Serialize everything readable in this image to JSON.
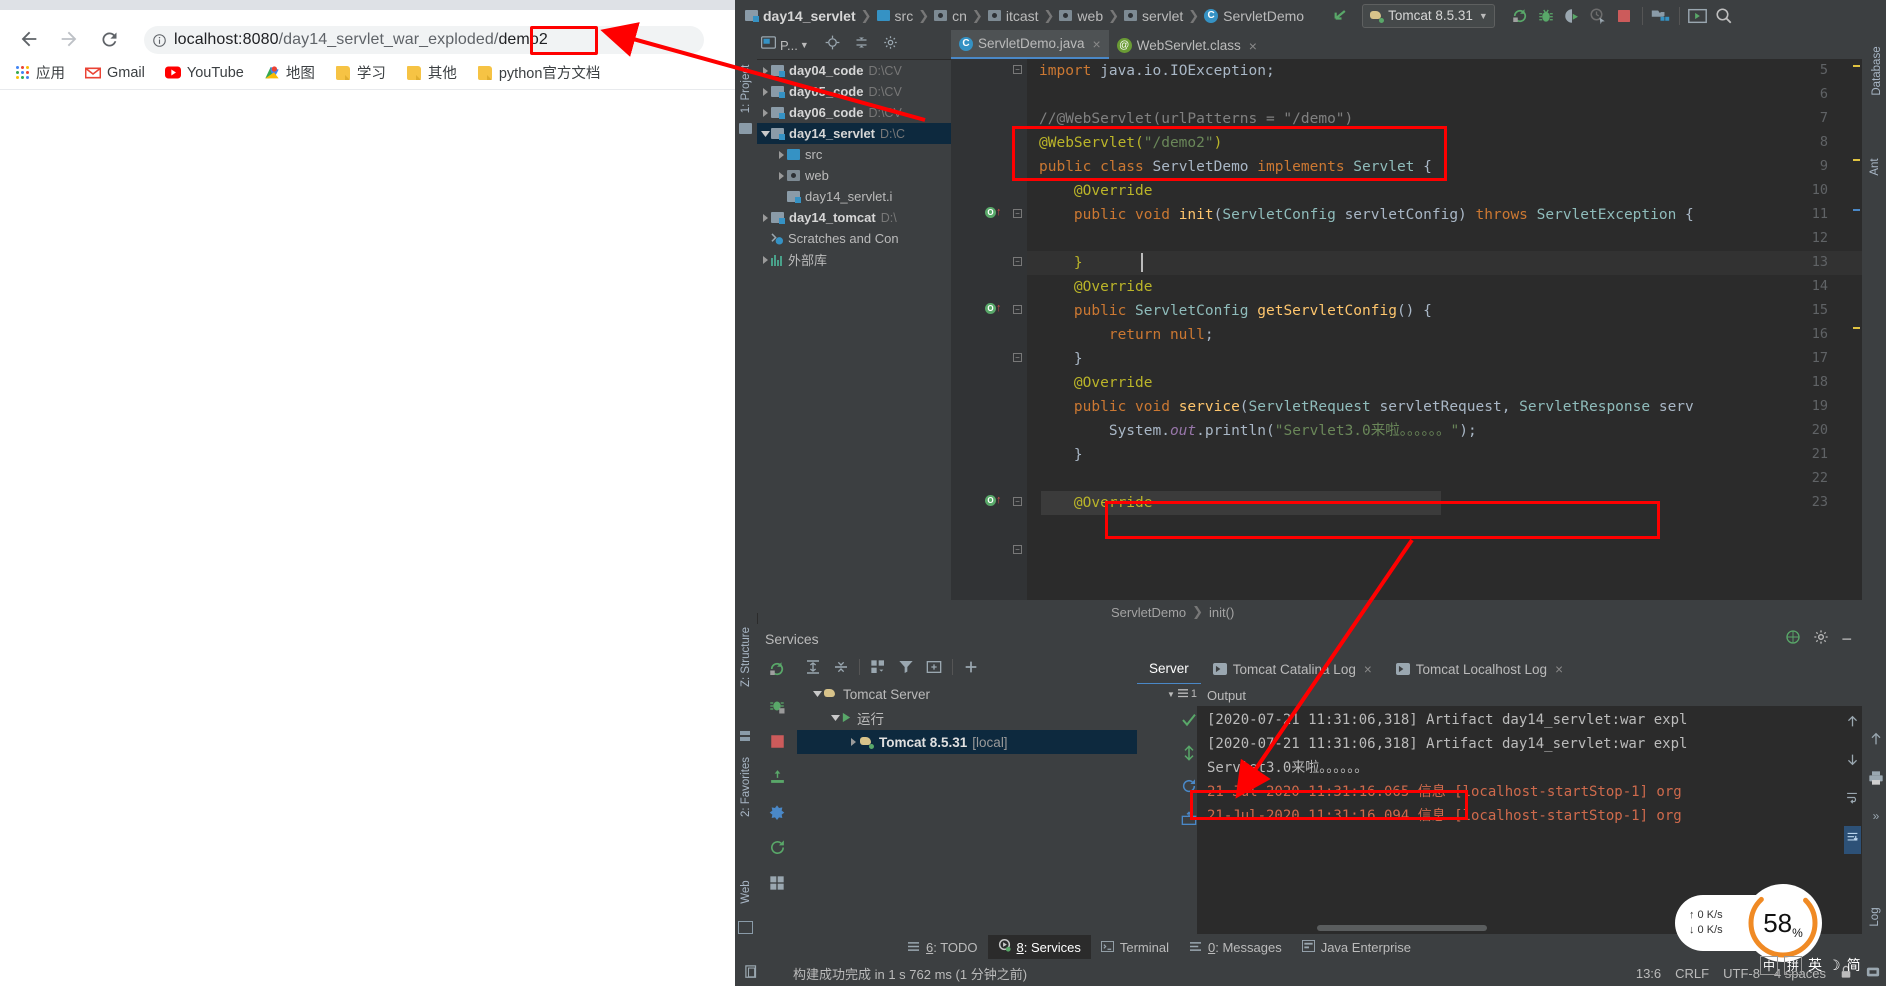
{
  "browser": {
    "nav": {
      "back": "back-arrow",
      "forward": "forward-arrow",
      "reload": "reload"
    },
    "omnibox": {
      "info_icon": "info-circle-icon",
      "host": "localhost:8080",
      "path": "/day14_servlet_war_exploded/",
      "highlight": "demo2",
      "full_url": "localhost:8080/day14_servlet_war_exploded/demo2"
    },
    "bookmarks": [
      {
        "label": "应用",
        "icon": "apps-grid-icon"
      },
      {
        "label": "Gmail",
        "icon": "gmail-icon"
      },
      {
        "label": "YouTube",
        "icon": "youtube-icon"
      },
      {
        "label": "地图",
        "icon": "maps-icon"
      },
      {
        "label": "学习",
        "icon": "folder-icon"
      },
      {
        "label": "其他",
        "icon": "folder-icon"
      },
      {
        "label": "python官方文档",
        "icon": "folder-icon"
      }
    ]
  },
  "idea": {
    "breadcrumb": [
      {
        "label": "day14_servlet",
        "icon": "module-icon",
        "bold": true
      },
      {
        "label": "src",
        "icon": "source-root-icon",
        "bold": false
      },
      {
        "label": "cn",
        "icon": "package-icon",
        "bold": false
      },
      {
        "label": "itcast",
        "icon": "package-icon",
        "bold": false
      },
      {
        "label": "web",
        "icon": "package-icon",
        "bold": false
      },
      {
        "label": "servlet",
        "icon": "package-icon",
        "bold": false
      },
      {
        "label": "ServletDemo",
        "icon": "class-icon",
        "bold": false
      }
    ],
    "run_config": {
      "label": "Tomcat 8.5.31",
      "icon": "tomcat-icon",
      "chevron": "▼"
    },
    "toolbar_icons": [
      "run-icon",
      "debug-icon",
      "run-coverage-icon",
      "profile-icon",
      "stop-icon",
      "build-artifacts-icon",
      "tomcat-console-icon",
      "search-everywhere-icon"
    ],
    "left_strip": [
      "1: Project",
      "Z: Structure",
      "2: Favorites",
      "Web"
    ],
    "right_strip": [
      "Database",
      "Ant"
    ],
    "project_panel": {
      "title": "P...",
      "tree": [
        {
          "label": "day04_code",
          "path": "D:\\CV",
          "indent": 0,
          "expander": "collapsed",
          "icon": "module-icon",
          "bold": true,
          "selected": false
        },
        {
          "label": "day05_code",
          "path": "D:\\CV",
          "indent": 0,
          "expander": "collapsed",
          "icon": "module-icon",
          "bold": true,
          "selected": false
        },
        {
          "label": "day06_code",
          "path": "D:\\CV",
          "indent": 0,
          "expander": "collapsed",
          "icon": "module-icon",
          "bold": true,
          "selected": false
        },
        {
          "label": "day14_servlet",
          "path": "D:\\C",
          "indent": 0,
          "expander": "expanded",
          "icon": "module-icon",
          "bold": true,
          "selected": true
        },
        {
          "label": "src",
          "path": "",
          "indent": 1,
          "expander": "collapsed",
          "icon": "source-root-icon",
          "bold": false,
          "selected": false
        },
        {
          "label": "web",
          "path": "",
          "indent": 1,
          "expander": "collapsed",
          "icon": "web-root-icon",
          "bold": false,
          "selected": false
        },
        {
          "label": "day14_servlet.i",
          "path": "",
          "indent": 1,
          "expander": "none",
          "icon": "iml-file-icon",
          "bold": false,
          "selected": false
        },
        {
          "label": "day14_tomcat",
          "path": "D:\\",
          "indent": 0,
          "expander": "collapsed",
          "icon": "module-icon",
          "bold": true,
          "selected": false
        },
        {
          "label": "Scratches and Con",
          "path": "",
          "indent": 0,
          "expander": "none",
          "icon": "scratches-icon",
          "bold": false,
          "selected": false
        },
        {
          "label": "外部库",
          "path": "",
          "indent": 0,
          "expander": "collapsed",
          "icon": "library-icon",
          "bold": false,
          "selected": false
        }
      ]
    },
    "editor": {
      "tabs": [
        {
          "label": "ServletDemo.java",
          "icon": "java-class-icon",
          "active": true,
          "closable": true
        },
        {
          "label": "WebServlet.class",
          "icon": "annotation-icon",
          "active": false,
          "closable": true
        }
      ],
      "first_line_number": 5,
      "lines": [
        {
          "n": 5,
          "text": "import java.io.IOException;"
        },
        {
          "n": 6,
          "text": ""
        },
        {
          "n": 7,
          "text": "//@WebServlet(urlPatterns = \"/demo\")"
        },
        {
          "n": 8,
          "text": "@WebServlet(\"/demo2\")"
        },
        {
          "n": 9,
          "text": "public class ServletDemo implements Servlet {"
        },
        {
          "n": 10,
          "text": "    @Override"
        },
        {
          "n": 11,
          "text": "    public void init(ServletConfig servletConfig) throws ServletException {"
        },
        {
          "n": 12,
          "text": ""
        },
        {
          "n": 13,
          "text": "    }"
        },
        {
          "n": 14,
          "text": "    @Override"
        },
        {
          "n": 15,
          "text": "    public ServletConfig getServletConfig() {"
        },
        {
          "n": 16,
          "text": "        return null;"
        },
        {
          "n": 17,
          "text": "    }"
        },
        {
          "n": 18,
          "text": "    @Override"
        },
        {
          "n": 19,
          "text": "    public void service(ServletRequest servletRequest, ServletResponse serv"
        },
        {
          "n": 20,
          "text": "        System.out.println(\"Servlet3.0来啦。。。。。。\");"
        },
        {
          "n": 21,
          "text": "    }"
        },
        {
          "n": 22,
          "text": ""
        },
        {
          "n": 23,
          "text": "    @Override"
        }
      ],
      "breadcrumb": [
        "ServletDemo",
        "init()"
      ],
      "caret_line": 13
    },
    "services": {
      "title": "Services",
      "toolbar_icons": [
        "rerun-icon",
        "expand-all-icon",
        "collapse-all-icon",
        "group-by-icon",
        "filter-icon",
        "add-frame-icon",
        "add-icon"
      ],
      "left_icons": [
        "rerun-icon",
        "debug-icon",
        "stop-icon",
        "deploy-icon",
        "settings-icon",
        "restart-icon",
        "layout-icon"
      ],
      "tree": [
        {
          "label": "Tomcat Server",
          "indent": 0,
          "expander": "expanded",
          "icon": "tomcat-icon",
          "bold": false,
          "selected": false
        },
        {
          "label": "运行",
          "indent": 1,
          "expander": "expanded",
          "icon": "run-green-icon",
          "bold": false,
          "selected": false
        },
        {
          "label": "Tomcat 8.5.31",
          "suffix": "[local]",
          "indent": 2,
          "expander": "collapsed",
          "icon": "tomcat-run-icon",
          "bold": true,
          "selected": true
        }
      ],
      "tabs": [
        {
          "label": "Server",
          "active": true,
          "closable": false,
          "icon": ""
        },
        {
          "label": "Tomcat Catalina Log",
          "active": false,
          "closable": true,
          "icon": "log-icon"
        },
        {
          "label": "Tomcat Localhost Log",
          "active": false,
          "closable": true,
          "icon": "log-icon"
        }
      ],
      "output_label": "Output",
      "filter_badge": "1",
      "console_lines": [
        {
          "text": "[2020-07-21 11:31:06,318] Artifact day14_servlet:war expl",
          "style": "normal"
        },
        {
          "text": "[2020-07-21 11:31:06,318] Artifact day14_servlet:war expl",
          "style": "normal"
        },
        {
          "text": "Servlet3.0来啦。。。。。。",
          "style": "normal"
        },
        {
          "text": "21-Jul-2020 11:31:16.065 信息 [localhost-startStop-1] org",
          "style": "error"
        },
        {
          "text": "21-Jul-2020 11:31:16.094 信息 [localhost-startStop-1] org",
          "style": "error"
        }
      ]
    },
    "bottom_tabs": [
      {
        "num": "6",
        "label": ": TODO",
        "icon": "todo-icon",
        "active": false
      },
      {
        "num": "8",
        "label": ": Services",
        "icon": "services-icon",
        "active": true
      },
      {
        "num": "",
        "label": "Terminal",
        "icon": "terminal-icon",
        "active": false
      },
      {
        "num": "0",
        "label": ": Messages",
        "icon": "messages-icon",
        "active": false
      },
      {
        "num": "",
        "label": "Java Enterprise",
        "icon": "java-enterprise-icon",
        "active": false
      }
    ],
    "statusbar": {
      "message": "构建成功完成 in 1 s 762 ms (1 分钟之前)",
      "caret_position": "13:6",
      "line_separator": "CRLF",
      "encoding": "UTF-8",
      "indent": "4 spaces",
      "lock_icon": "lock-icon"
    }
  },
  "overlay": {
    "net_up": "↑ 0   K/s",
    "net_down": "↓ 0   K/s",
    "cpu_value": "58",
    "cpu_unit": "%",
    "tray_items": [
      "中",
      "拼",
      "英",
      "☽",
      "简"
    ],
    "annotation_color": "#ff0000"
  },
  "colors": {
    "idea_bg": "#3c3f41",
    "editor_bg": "#2b2b2b",
    "selection": "#0d293e",
    "accent": "#4a88c7",
    "annotation_red": "#ff0000",
    "green": "#59a869"
  }
}
